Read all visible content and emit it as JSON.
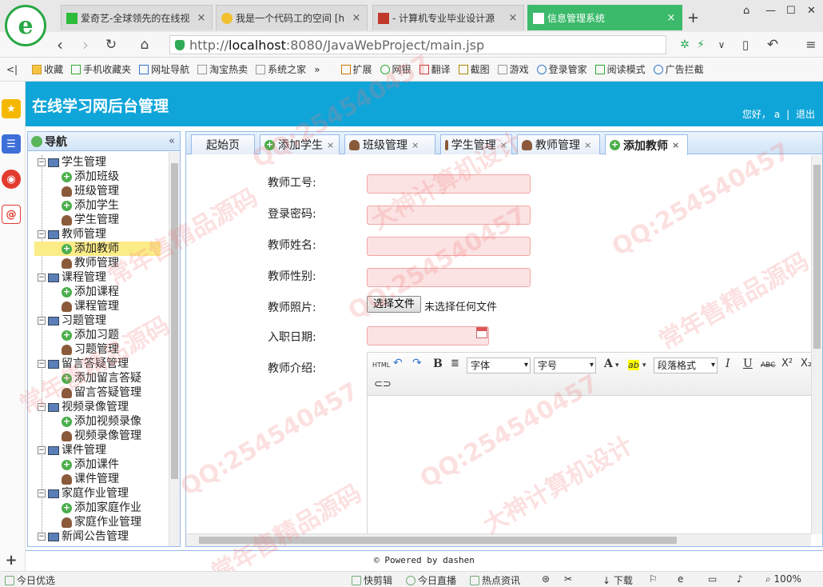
{
  "browser": {
    "tabs": [
      {
        "title": "爱奇艺-全球领先的在线视",
        "active": false
      },
      {
        "title": "我是一个代码工的空间 [h",
        "active": false
      },
      {
        "title": "- 计算机专业毕业设计源",
        "active": false
      },
      {
        "title": "信息管理系统",
        "active": true
      }
    ],
    "new_tab": "+",
    "url_prefix": "http://",
    "url_host": "localhost",
    "url_rest": ":8080/JavaWebProject/main.jsp",
    "bookmarks": [
      "收藏",
      "手机收藏夹",
      "网址导航",
      "淘宝热卖",
      "系统之家",
      "»"
    ],
    "extensions": [
      "扩展",
      "网银",
      "翻译",
      "截图",
      "游戏",
      "登录管家",
      "阅读模式",
      "广告拦截"
    ]
  },
  "header": {
    "title": "在线学习网后台管理",
    "greeting": "您好，",
    "user": "a",
    "separator": "|",
    "logout": "退出"
  },
  "nav": {
    "title": "导航",
    "collapse": "«",
    "tree": [
      {
        "label": "学生管理",
        "type": "group"
      },
      {
        "label": "添加班级",
        "type": "add"
      },
      {
        "label": "班级管理",
        "type": "manage"
      },
      {
        "label": "添加学生",
        "type": "add"
      },
      {
        "label": "学生管理",
        "type": "manage"
      },
      {
        "label": "教师管理",
        "type": "group"
      },
      {
        "label": "添加教师",
        "type": "add",
        "selected": true
      },
      {
        "label": "教师管理",
        "type": "manage"
      },
      {
        "label": "课程管理",
        "type": "group"
      },
      {
        "label": "添加课程",
        "type": "add"
      },
      {
        "label": "课程管理",
        "type": "manage"
      },
      {
        "label": "习题管理",
        "type": "group"
      },
      {
        "label": "添加习题",
        "type": "add"
      },
      {
        "label": "习题管理",
        "type": "manage"
      },
      {
        "label": "留言答疑管理",
        "type": "group"
      },
      {
        "label": "添加留言答疑",
        "type": "add"
      },
      {
        "label": "留言答疑管理",
        "type": "manage"
      },
      {
        "label": "视频录像管理",
        "type": "group"
      },
      {
        "label": "添加视频录像",
        "type": "add"
      },
      {
        "label": "视频录像管理",
        "type": "manage"
      },
      {
        "label": "课件管理",
        "type": "group"
      },
      {
        "label": "添加课件",
        "type": "add"
      },
      {
        "label": "课件管理",
        "type": "manage"
      },
      {
        "label": "家庭作业管理",
        "type": "group"
      },
      {
        "label": "添加家庭作业",
        "type": "add"
      },
      {
        "label": "家庭作业管理",
        "type": "manage"
      },
      {
        "label": "新闻公告管理",
        "type": "group"
      }
    ]
  },
  "tabs": [
    {
      "label": "起始页",
      "icon": "none"
    },
    {
      "label": "添加学生",
      "icon": "add"
    },
    {
      "label": "班级管理",
      "icon": "manage"
    },
    {
      "label": "学生管理",
      "icon": "manage"
    },
    {
      "label": "教师管理",
      "icon": "manage"
    },
    {
      "label": "添加教师",
      "icon": "add",
      "active": true
    }
  ],
  "form": {
    "teacher_no_label": "教师工号:",
    "password_label": "登录密码:",
    "name_label": "教师姓名:",
    "sex_label": "教师性别:",
    "photo_label": "教师照片:",
    "choose_file": "选择文件",
    "no_file": "未选择任何文件",
    "date_label": "入职日期:",
    "intro_label": "教师介绍:"
  },
  "editor": {
    "html": "HTML",
    "font": "字体",
    "size": "字号",
    "paragraph": "段落格式",
    "bold": "B",
    "italic": "I",
    "underline": "U",
    "strike": "ABC",
    "superscript": "X²",
    "subscript": "X₂",
    "font_color": "A",
    "highlight": "ab"
  },
  "footer": "© Powered by dashen",
  "statusbar": [
    "今日优选",
    "快剪辑",
    "今日直播",
    "热点资讯",
    "下载",
    "100%"
  ],
  "watermarks": [
    "QQ:254540457",
    "常年售精品源码",
    "大神计算机设计"
  ],
  "colors": {
    "header": "#0fa5d9",
    "input_bg": "#fbe3e3",
    "selected": "#fbec88",
    "active_browser_tab": "#3cba6b"
  }
}
